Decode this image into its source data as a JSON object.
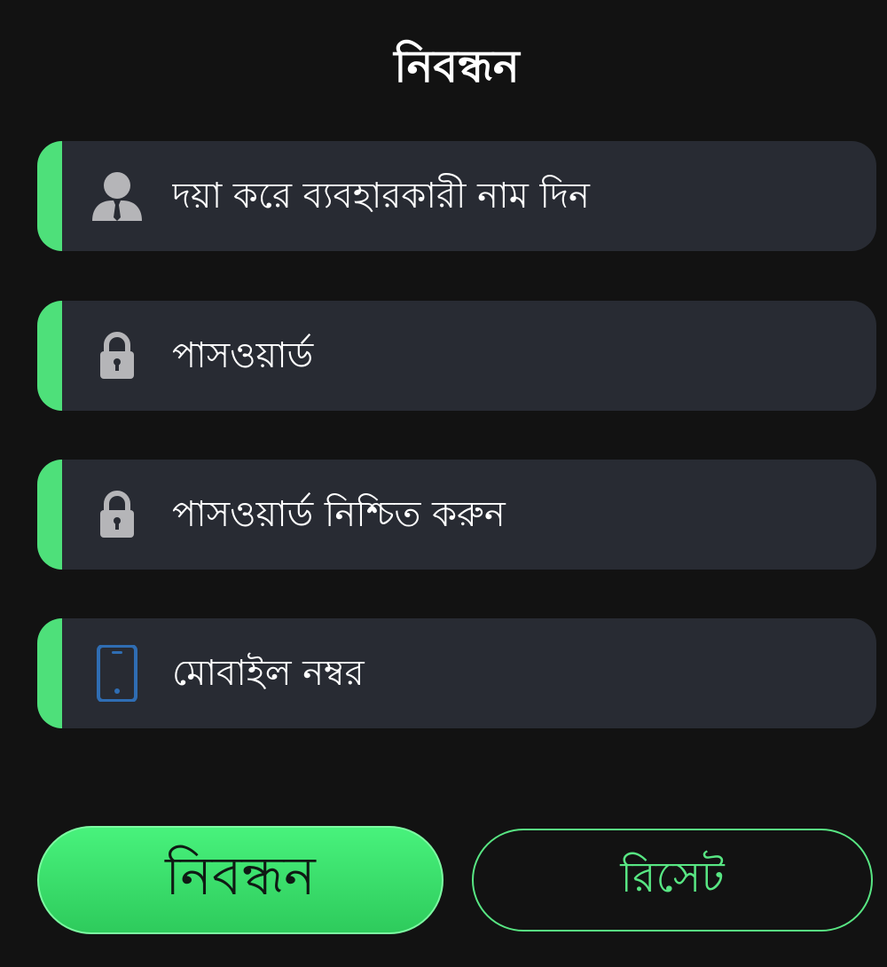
{
  "page": {
    "title": "নিবন্ধন"
  },
  "form": {
    "username": {
      "placeholder": "দয়া করে ব্যবহারকারী নাম দিন",
      "value": "",
      "icon": "user-icon"
    },
    "password": {
      "placeholder": "পাসওয়ার্ড",
      "value": "",
      "icon": "lock-icon"
    },
    "confirm_password": {
      "placeholder": "পাসওয়ার্ড নিশ্চিত করুন",
      "value": "",
      "icon": "lock-icon"
    },
    "mobile": {
      "placeholder": "মোবাইল নম্বর",
      "value": "",
      "icon": "mobile-phone-icon"
    }
  },
  "actions": {
    "register_label": "নিবন্ধন",
    "reset_label": "রিসেট"
  },
  "colors": {
    "background": "#121212",
    "field_background": "#282b33",
    "accent": "#4ee07a",
    "icon_gray": "#b5b5b8",
    "phone_blue": "#2f6db3"
  }
}
